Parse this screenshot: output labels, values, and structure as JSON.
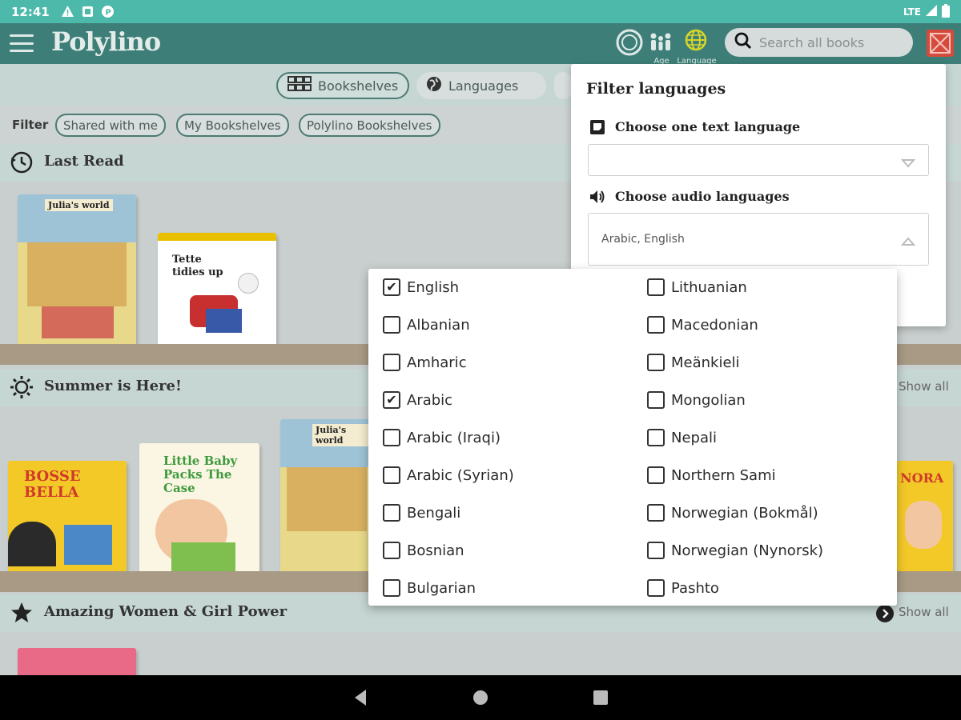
{
  "status_bar": {
    "time": "12:41",
    "network": "LTE",
    "icons": [
      "warning-icon",
      "notification-icon",
      "app-icon"
    ]
  },
  "app_bar": {
    "logo": "Polylino",
    "age_label": "Age",
    "language_label": "Language",
    "search_placeholder": "Search all books"
  },
  "nav": {
    "bookshelves": "Bookshelves",
    "languages": "Languages"
  },
  "filter": {
    "label": "Filter",
    "chips": [
      "Shared with me",
      "My Bookshelves",
      "Polylino Bookshelves"
    ]
  },
  "sections": [
    {
      "title": "Last Read",
      "icon": "history-icon",
      "show_all": ""
    },
    {
      "title": "Summer is Here!",
      "icon": "sun-icon",
      "show_all": "Show all"
    },
    {
      "title": "Amazing Women & Girl Power",
      "icon": "star-icon",
      "show_all": "Show all"
    }
  ],
  "books": {
    "julia_title": "Julia's world",
    "tette_title": "Tette tidies up",
    "bosse_title": "BOSSE BELLA",
    "baby_title": "Little Baby Packs The Case",
    "nora_title": "NORA"
  },
  "lang_panel": {
    "title": "Filter languages",
    "text_language_label": "Choose one text language",
    "text_language_value": "",
    "audio_language_label": "Choose audio languages",
    "audio_language_value": "Arabic, English"
  },
  "language_options": {
    "left": [
      {
        "name": "English",
        "checked": true
      },
      {
        "name": "Albanian",
        "checked": false
      },
      {
        "name": "Amharic",
        "checked": false
      },
      {
        "name": "Arabic",
        "checked": true
      },
      {
        "name": "Arabic (Iraqi)",
        "checked": false
      },
      {
        "name": "Arabic (Syrian)",
        "checked": false
      },
      {
        "name": "Bengali",
        "checked": false
      },
      {
        "name": "Bosnian",
        "checked": false
      },
      {
        "name": "Bulgarian",
        "checked": false
      }
    ],
    "right": [
      {
        "name": "Lithuanian",
        "checked": false
      },
      {
        "name": "Macedonian",
        "checked": false
      },
      {
        "name": "Meänkieli",
        "checked": false
      },
      {
        "name": "Mongolian",
        "checked": false
      },
      {
        "name": "Nepali",
        "checked": false
      },
      {
        "name": "Northern Sami",
        "checked": false
      },
      {
        "name": "Norwegian (Bokmål)",
        "checked": false
      },
      {
        "name": "Norwegian (Nynorsk)",
        "checked": false
      },
      {
        "name": "Pashto",
        "checked": false
      }
    ]
  },
  "colors": {
    "teal": "#4db9ab",
    "appbar": "#3d7f78",
    "shelf": "#a89a84"
  }
}
